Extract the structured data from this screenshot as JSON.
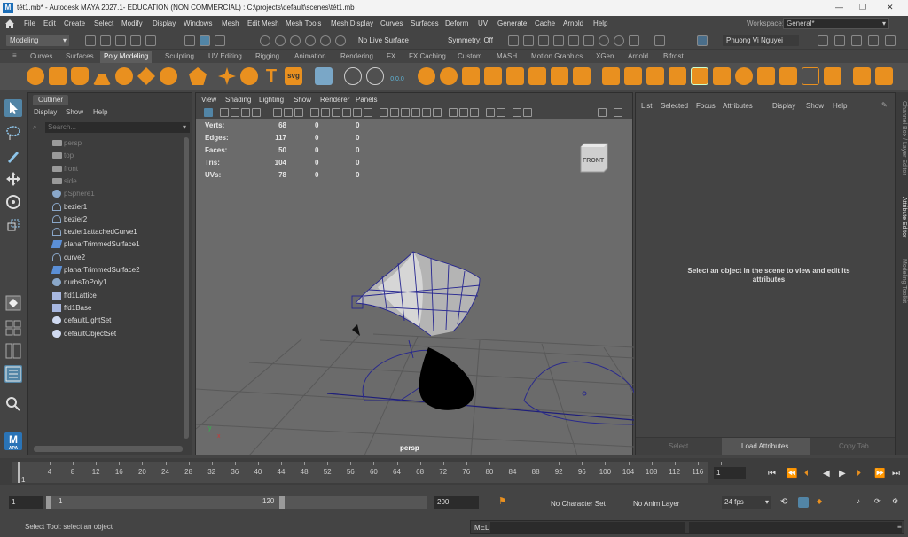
{
  "title_bar": {
    "app_icon": "M",
    "title": "tét1.mb* - Autodesk MAYA 2027.1- EDUCATION (NON COMMERCIAL) : C:\\projects\\default\\scenes\\tét1.mb",
    "minimize": "—",
    "maximize": "❐",
    "close": "✕"
  },
  "menubar": {
    "items": [
      "File",
      "Edit",
      "Create",
      "Select",
      "Modify",
      "Display",
      "Windows",
      "Mesh",
      "Edit Mesh",
      "Mesh Tools",
      "Mesh Display",
      "Curves",
      "Surfaces",
      "Deform",
      "UV",
      "Generate",
      "Cache",
      "Arnold",
      "Help"
    ],
    "workspace_label": "Workspace:",
    "workspace_value": "General*"
  },
  "statusline": {
    "menuset": "Modeling",
    "live_surface": "No Live Surface",
    "symmetry": "Symmetry: Off",
    "user": "Phuong Vi Nguyei"
  },
  "shelf_tabs": {
    "items": [
      "Curves",
      "Surfaces",
      "Poly Modeling",
      "Sculpting",
      "UV Editing",
      "Rigging",
      "Animation",
      "Rendering",
      "FX",
      "FX Caching",
      "Custom",
      "MASH",
      "Motion Graphics",
      "XGen",
      "Arnold",
      "Bifrost"
    ],
    "active": "Poly Modeling"
  },
  "shelf": {
    "text_tool": "T",
    "svg_tool": "svg",
    "counter": "0.0.0"
  },
  "outliner": {
    "tab": "Outliner",
    "menu": [
      "Display",
      "Show",
      "Help"
    ],
    "search_placeholder": "Search...",
    "items": [
      {
        "label": "persp",
        "icon": "camera-icon",
        "dim": true
      },
      {
        "label": "top",
        "icon": "camera-icon",
        "dim": true
      },
      {
        "label": "front",
        "icon": "camera-icon",
        "dim": true
      },
      {
        "label": "side",
        "icon": "camera-icon",
        "dim": true
      },
      {
        "label": "pSphere1",
        "icon": "mesh-icon",
        "dim": true
      },
      {
        "label": "bezier1",
        "icon": "curve-icon",
        "dim": false
      },
      {
        "label": "bezier2",
        "icon": "curve-icon",
        "dim": false
      },
      {
        "label": "bezier1attachedCurve1",
        "icon": "curve-icon",
        "dim": false
      },
      {
        "label": "planarTrimmedSurface1",
        "icon": "surface-icon",
        "dim": false
      },
      {
        "label": "curve2",
        "icon": "curve-icon",
        "dim": false
      },
      {
        "label": "planarTrimmedSurface2",
        "icon": "surface-icon",
        "dim": false
      },
      {
        "label": "nurbsToPoly1",
        "icon": "mesh-icon",
        "dim": false
      },
      {
        "label": "ffd1Lattice",
        "icon": "lattice-icon",
        "dim": false
      },
      {
        "label": "ffd1Base",
        "icon": "lattice-icon",
        "dim": false
      },
      {
        "label": "defaultLightSet",
        "icon": "set-icon",
        "dim": false
      },
      {
        "label": "defaultObjectSet",
        "icon": "set-icon",
        "dim": false
      }
    ]
  },
  "viewport": {
    "menu": [
      "View",
      "Shading",
      "Lighting",
      "Show",
      "Renderer",
      "Panels"
    ],
    "hud": [
      {
        "label": "Verts:",
        "a": "68",
        "b": "0",
        "c": "0"
      },
      {
        "label": "Edges:",
        "a": "117",
        "b": "0",
        "c": "0"
      },
      {
        "label": "Faces:",
        "a": "50",
        "b": "0",
        "c": "0"
      },
      {
        "label": "Tris:",
        "a": "104",
        "b": "0",
        "c": "0"
      },
      {
        "label": "UVs:",
        "a": "78",
        "b": "0",
        "c": "0"
      }
    ],
    "viewcube_label": "FRONT",
    "camera_label": "persp",
    "axis_y": "y",
    "axis_x": "x"
  },
  "attribute_editor": {
    "menu": [
      "List",
      "Selected",
      "Focus",
      "Attributes",
      "Display",
      "Show",
      "Help"
    ],
    "message": "Select an object in the scene to view and edit its attributes",
    "select_button": "Select",
    "load_button": "Load Attributes",
    "copy_button": "Copy Tab"
  },
  "side_tabs": [
    "Channel Box / Layer Editor",
    "Attribute Editor",
    "Modeling Toolkit"
  ],
  "time_slider": {
    "ticks": [
      "4",
      "8",
      "12",
      "16",
      "20",
      "24",
      "28",
      "32",
      "36",
      "40",
      "44",
      "48",
      "52",
      "56",
      "60",
      "64",
      "68",
      "72",
      "76",
      "80",
      "84",
      "88",
      "92",
      "96",
      "100",
      "104",
      "108",
      "112",
      "116",
      "12"
    ],
    "start_marker": "1",
    "current_frame": "1"
  },
  "range_slider": {
    "start": "1",
    "inner_start": "1",
    "inner_end": "120",
    "end": "200",
    "character_set": "No Character Set",
    "anim_layer": "No Anim Layer",
    "fps": "24 fps"
  },
  "help_line": {
    "text": "Select Tool: select an object",
    "mel_label": "MEL"
  },
  "toolbox": {
    "logo_label": "M",
    "logo_sub": "APA"
  }
}
